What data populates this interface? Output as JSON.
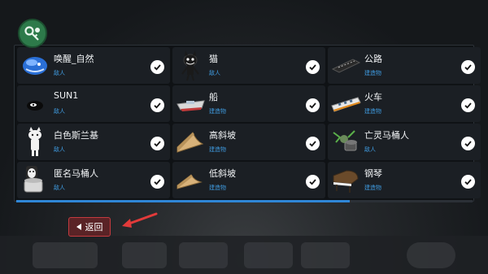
{
  "items": [
    {
      "name": "唤醒_自然",
      "tag": "敌人",
      "icon": "blue-orb-creature-icon"
    },
    {
      "name": "猫",
      "tag": "敌人",
      "icon": "cartoon-cat-icon"
    },
    {
      "name": "公路",
      "tag": "建造物",
      "icon": "road-segment-icon"
    },
    {
      "name": "SUN1",
      "tag": "敌人",
      "icon": "dark-eye-creature-icon"
    },
    {
      "name": "船",
      "tag": "建造物",
      "icon": "boat-icon"
    },
    {
      "name": "火车",
      "tag": "建造物",
      "icon": "train-icon"
    },
    {
      "name": "白色斯兰基",
      "tag": "敌人",
      "icon": "white-cat-figure-icon"
    },
    {
      "name": "高斜坡",
      "tag": "建造物",
      "icon": "high-ramp-icon"
    },
    {
      "name": "亡灵马桶人",
      "tag": "敌人",
      "icon": "zombie-toilet-icon"
    },
    {
      "name": "匿名马桶人",
      "tag": "敌人",
      "icon": "masked-toilet-icon"
    },
    {
      "name": "低斜坡",
      "tag": "建造物",
      "icon": "low-ramp-icon"
    },
    {
      "name": "钢琴",
      "tag": "建造物",
      "icon": "piano-icon"
    }
  ],
  "back_button": {
    "label": "返回"
  },
  "scroll": {
    "position_fraction": 0.73
  },
  "colors": {
    "accent_blue": "#2f86d6",
    "back_red": "#c43a3f",
    "mod_green": "#2d7a4a"
  }
}
